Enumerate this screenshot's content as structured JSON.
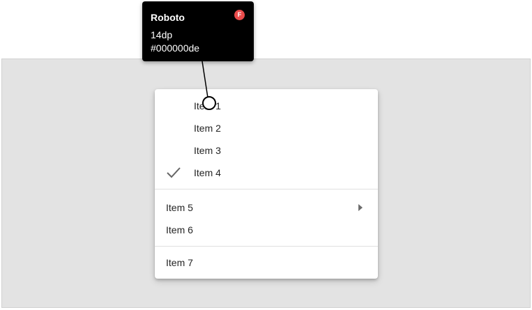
{
  "tooltip": {
    "font_name": "Roboto",
    "badge": "F",
    "font_size": "14dp",
    "font_color": "#000000de",
    "badge_color": "#e94b4b"
  },
  "menu": {
    "items": [
      {
        "label": "Item 1",
        "checked": false,
        "has_submenu": false
      },
      {
        "label": "Item 2",
        "checked": false,
        "has_submenu": false
      },
      {
        "label": "Item 3",
        "checked": false,
        "has_submenu": false
      },
      {
        "label": "Item 4",
        "checked": true,
        "has_submenu": false
      },
      {
        "label": "Item 5",
        "checked": false,
        "has_submenu": true
      },
      {
        "label": "Item 6",
        "checked": false,
        "has_submenu": false
      },
      {
        "label": "Item 7",
        "checked": false,
        "has_submenu": false
      }
    ],
    "check_icon": "check-icon",
    "submenu_icon": "arrow-right-icon"
  },
  "colors": {
    "canvas_background": "#e3e3e3",
    "menu_background": "#ffffff",
    "divider": "#e0e0e0",
    "text": "#000000de"
  }
}
